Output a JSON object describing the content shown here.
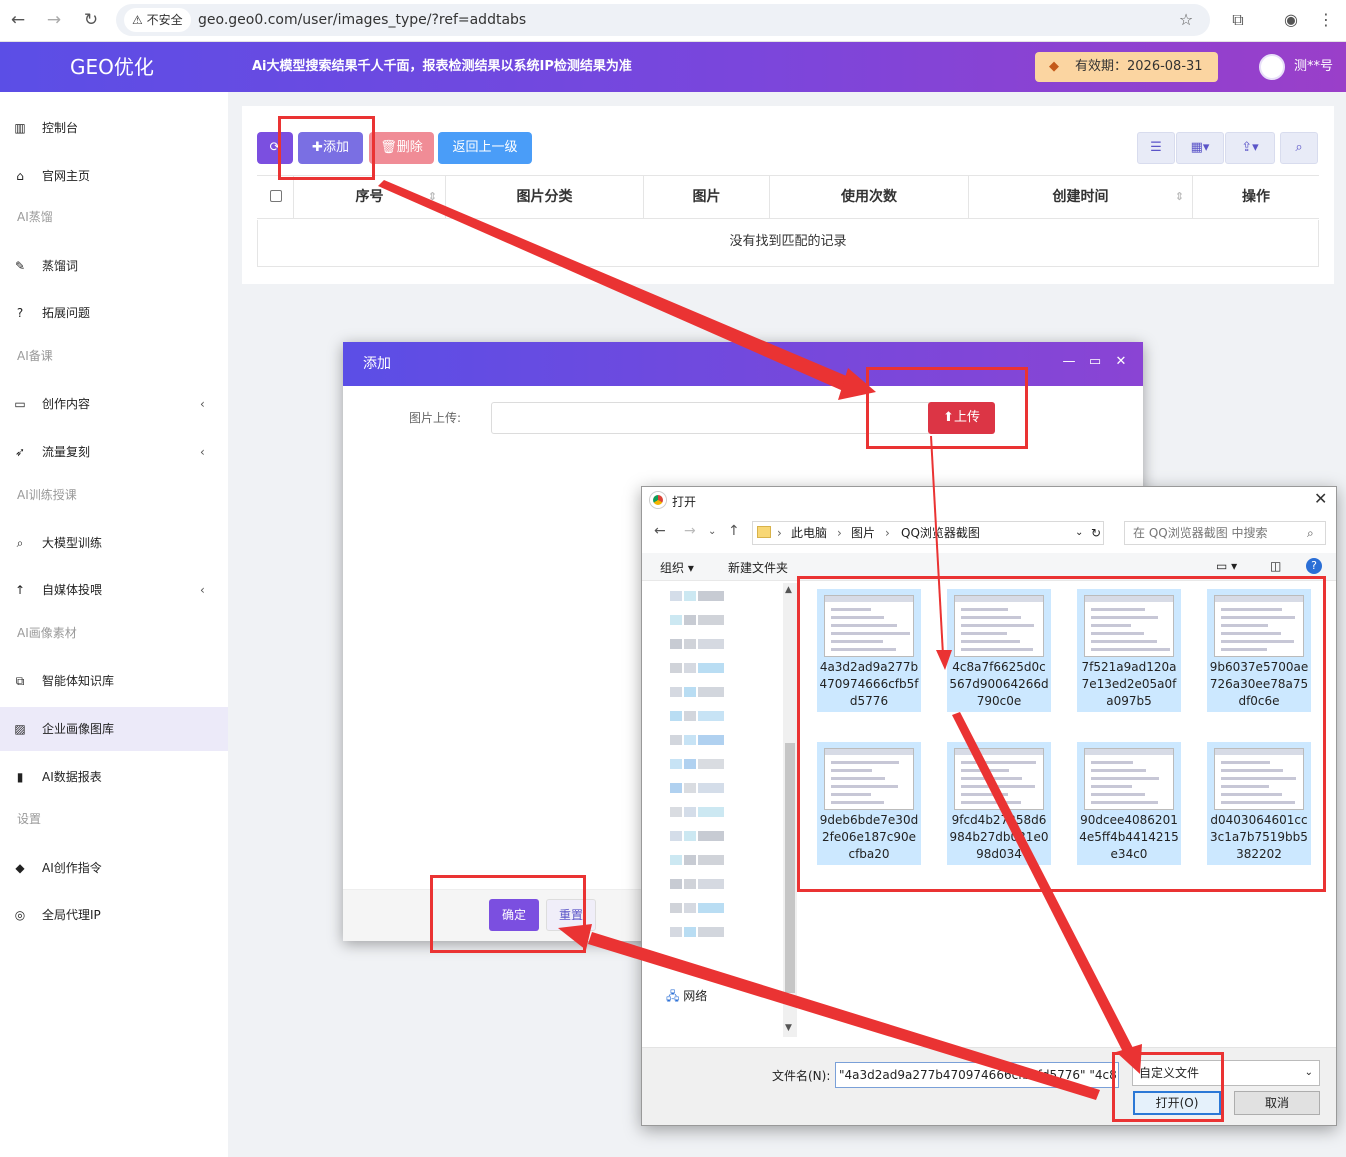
{
  "browser": {
    "insecure_label": "不安全",
    "url": "geo.geo0.com/user/images_type/?ref=addtabs"
  },
  "header": {
    "logo": "GEO优化",
    "slogan": "Ai大模型搜索结果千人千面，报表检测结果以系统IP检测结果为准",
    "validity": "有效期：2026-08-31",
    "username": "测**号"
  },
  "sidebar": {
    "items": [
      {
        "label": "控制台",
        "icon": "chart-bar-icon"
      },
      {
        "label": "官网主页",
        "icon": "home-icon"
      },
      {
        "group": "AI蒸馏"
      },
      {
        "label": "蒸馏词",
        "icon": "paperclip-icon"
      },
      {
        "label": "拓展问题",
        "icon": "question-icon"
      },
      {
        "group": "AI备课"
      },
      {
        "label": "创作内容",
        "icon": "folder-open-icon",
        "chevron": "‹"
      },
      {
        "label": "流量复刻",
        "icon": "rocket-icon",
        "chevron": "‹"
      },
      {
        "group": "AI训练授课"
      },
      {
        "label": "大模型训练",
        "icon": "search-icon"
      },
      {
        "label": "自媒体投喂",
        "icon": "arrow-up-icon",
        "chevron": "‹"
      },
      {
        "group": "AI画像素材"
      },
      {
        "label": "智能体知识库",
        "icon": "copy-icon"
      },
      {
        "label": "企业画像图库",
        "icon": "image-icon",
        "active": true
      },
      {
        "label": "AI数据报表",
        "icon": "signal-icon"
      },
      {
        "group": "设置"
      },
      {
        "label": "AI创作指令",
        "icon": "tag-icon"
      },
      {
        "label": "全局代理IP",
        "icon": "chrome-icon"
      }
    ]
  },
  "toolbar": {
    "refresh_icon": "refresh-icon",
    "add_label": "✚添加",
    "delete_label": "删除",
    "back_label": "返回上一级"
  },
  "table": {
    "columns": [
      "序号",
      "图片分类",
      "图片",
      "使用次数",
      "创建时间",
      "操作"
    ],
    "empty_text": "没有找到匹配的记录"
  },
  "modal": {
    "title": "添加",
    "field_label": "图片上传:",
    "upload_label": "上传",
    "ok_label": "确定",
    "reset_label": "重置"
  },
  "file_dialog": {
    "title": "打开",
    "breadcrumb": [
      "此电脑",
      "图片",
      "QQ浏览器截图"
    ],
    "search_placeholder": "在 QQ浏览器截图 中搜索",
    "organize_label": "组织 ▾",
    "new_folder_label": "新建文件夹",
    "network_label": "网络",
    "files": [
      "4a3d2ad9a277b470974666cfb5fd5776",
      "4c8a7f6625d0c567d90064266d790c0e",
      "7f521a9ad120a7e13ed2e05a0fa097b5",
      "9b6037e5700ae726a30ee78a75df0c6e",
      "9deb6bde7e30d2fe06e187c90ecfba20",
      "9fcd4b27258d6984b27db031e098d034",
      "90dcee40862014e5ff4b4414215e34c0",
      "d0403064601cc3c1a7b7519bb5382202"
    ],
    "filename_label": "文件名(N):",
    "filename_value": "\"4a3d2ad9a277b470974666cfb5fd5776\" \"4c8",
    "filetype_value": "自定义文件",
    "open_label": "打开(O)",
    "cancel_label": "取消"
  },
  "colors": {
    "brand_gradient_start": "#5b4ee6",
    "brand_gradient_end": "#9a3fc9",
    "danger": "#dc3545",
    "annotation_red": "#ea3333"
  }
}
